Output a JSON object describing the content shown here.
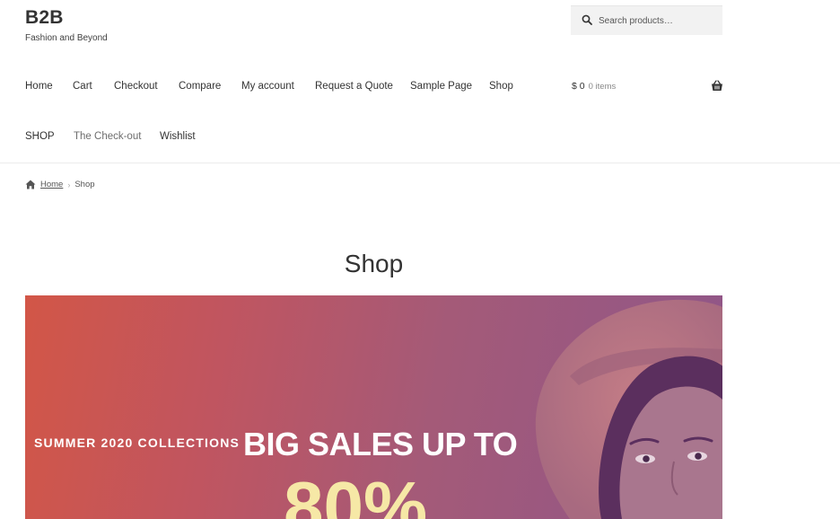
{
  "site": {
    "title": "B2B",
    "tagline": "Fashion and Beyond"
  },
  "search": {
    "placeholder": "Search products…"
  },
  "nav": {
    "items": [
      {
        "label": "Home"
      },
      {
        "label": "Cart"
      },
      {
        "label": "Checkout"
      },
      {
        "label": "Compare"
      },
      {
        "label": "My account"
      },
      {
        "label": "Request a Quote"
      },
      {
        "label": "Sample Page"
      },
      {
        "label": "Shop"
      },
      {
        "label": "SHOP"
      },
      {
        "label": "The Check-out"
      },
      {
        "label": "Wishlist"
      }
    ]
  },
  "cart": {
    "amount": "$ 0",
    "count": "0 items"
  },
  "breadcrumb": {
    "home": "Home",
    "current": "Shop"
  },
  "page": {
    "title": "Shop"
  },
  "banner": {
    "eyebrow": "SUMMER 2020 COLLECTIONS",
    "headline": "BIG SALES UP TO",
    "percent": "80%"
  },
  "colors": {
    "text": "#333333",
    "banner_start": "#d25647",
    "banner_end": "#8f5689",
    "percent": "#f6e8a6"
  }
}
